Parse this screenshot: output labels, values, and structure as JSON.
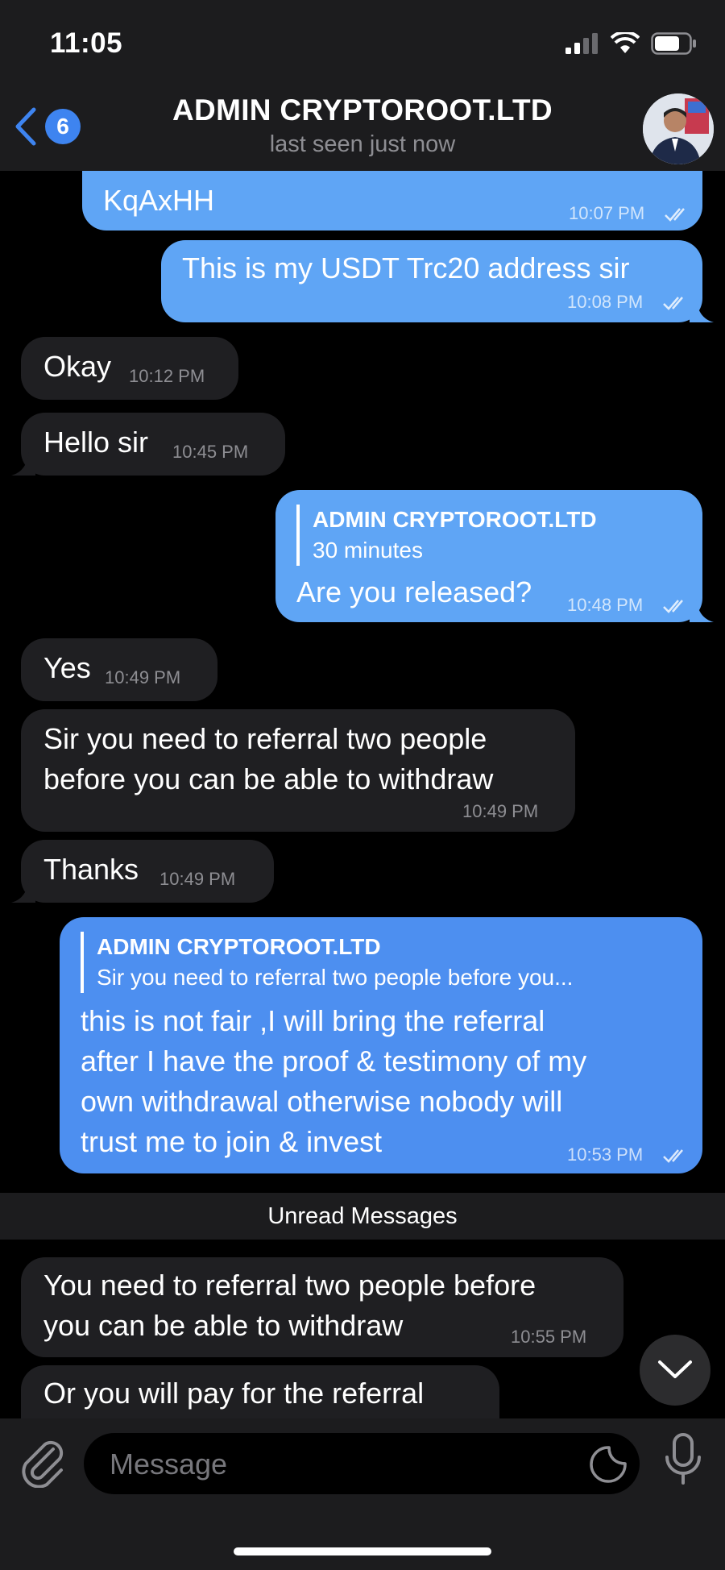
{
  "status_bar": {
    "time": "11:05"
  },
  "header": {
    "back_count": "6",
    "title": "ADMIN CRYPTOROOT.LTD",
    "subtitle": "last seen just now"
  },
  "messages": [
    {
      "direction": "out",
      "text_lines": [
        "KqAxHH"
      ],
      "time": "10:07 PM",
      "read": true
    },
    {
      "direction": "out",
      "text_lines": [
        "This is my USDT Trc20 address sir"
      ],
      "time": "10:08 PM",
      "read": true
    },
    {
      "direction": "in",
      "text_lines": [
        "Okay"
      ],
      "time": "10:12 PM"
    },
    {
      "direction": "in",
      "text_lines": [
        "Hello sir"
      ],
      "time": "10:45 PM"
    },
    {
      "direction": "out",
      "reply_to": {
        "name": "ADMIN CRYPTOROOT.LTD",
        "text": "30 minutes"
      },
      "text_lines": [
        "Are you released?"
      ],
      "time": "10:48 PM",
      "read": true
    },
    {
      "direction": "in",
      "text_lines": [
        "Yes"
      ],
      "time": "10:49 PM"
    },
    {
      "direction": "in",
      "text_lines": [
        "Sir you need to referral two people",
        "before you can be able to withdraw"
      ],
      "time": "10:49 PM"
    },
    {
      "direction": "in",
      "text_lines": [
        "Thanks"
      ],
      "time": "10:49 PM"
    },
    {
      "direction": "out",
      "reply_to": {
        "name": "ADMIN CRYPTOROOT.LTD",
        "text": "Sir you need to referral two people before you..."
      },
      "text_lines": [
        "this is not fair ,I will bring the referral",
        "after I have the proof & testimony of my",
        "own withdrawal otherwise nobody will",
        "trust me to join & invest"
      ],
      "time": "10:53 PM",
      "read": true
    },
    {
      "direction": "in",
      "text_lines": [
        "You need to referral two people before",
        "you can be able to withdraw"
      ],
      "time": "10:55 PM"
    },
    {
      "direction": "in",
      "text_lines": [
        "Or you will pay for the referral"
      ],
      "time": ""
    }
  ],
  "unread_label": "Unread Messages",
  "input": {
    "placeholder": "Message"
  },
  "icons": {
    "back": "chevron-left-icon",
    "attach": "paperclip-icon",
    "sticker": "sticker-icon",
    "mic": "microphone-icon",
    "scroll": "chevron-down-icon"
  },
  "colors": {
    "outgoing": "#5fa5f5",
    "outgoing_alt": "#4d8ff0",
    "incoming": "#1f1f22",
    "accent": "#3e84f0",
    "background": "#000000"
  }
}
